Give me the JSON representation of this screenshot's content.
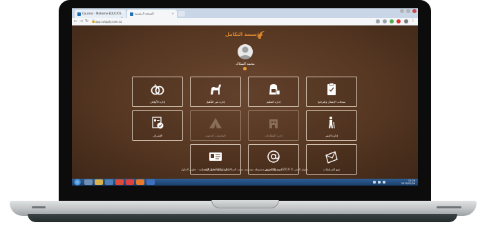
{
  "browser": {
    "tabs": [
      {
        "title": "Courses - Moheme EDUCATI...",
        "active": false
      },
      {
        "title": "الصفحة الرئيسية",
        "active": true
      }
    ],
    "url": "app.sutqaly.com.sa"
  },
  "site": {
    "logo_text": "مؤسسة التكامل"
  },
  "user": {
    "name": "محمد السلاك"
  },
  "tiles": [
    {
      "label": "إدارة الأوقاف",
      "icon": "rings-icon",
      "enabled": true
    },
    {
      "label": "إدارة غير التأهيل",
      "icon": "camel-icon",
      "enabled": true
    },
    {
      "label": "إدارة التعليم",
      "icon": "backpack-icon",
      "enabled": true
    },
    {
      "label": "سجلات الإعمال والبرامج",
      "icon": "clipboard-icon",
      "enabled": true
    },
    {
      "label": "الإشراف",
      "icon": "checklist-icon",
      "enabled": true
    },
    {
      "label": "المخيمات الدعوية",
      "icon": "tent-icon",
      "enabled": false
    },
    {
      "label": "إدارة القطاعات",
      "icon": "building-icon",
      "enabled": false
    },
    {
      "label": "إدارة العمر",
      "icon": "elderly-icon",
      "enabled": true
    },
    {
      "label": "إدارة وكالة جامع الوحدة",
      "icon": "id-card-icon",
      "enabled": true
    },
    {
      "label": "البريد الإلكتروني",
      "icon": "at-icon",
      "enabled": true
    },
    {
      "label": "تتبع المراسلات",
      "icon": "envelope-icon",
      "enabled": true
    }
  ],
  "footer": "حقوق النشر © 2019 - جميع الحقوق محفوظة مؤسسة محمد السلاك للتعليم والأعمال الإنسانية - تطوير الحلول",
  "taskbar": {
    "time": "12:28",
    "date": "2019/01/09"
  },
  "colors": {
    "page_background": "#5b3a26",
    "accent": "#e08a2c",
    "taskbar": "#1b3f6c"
  }
}
